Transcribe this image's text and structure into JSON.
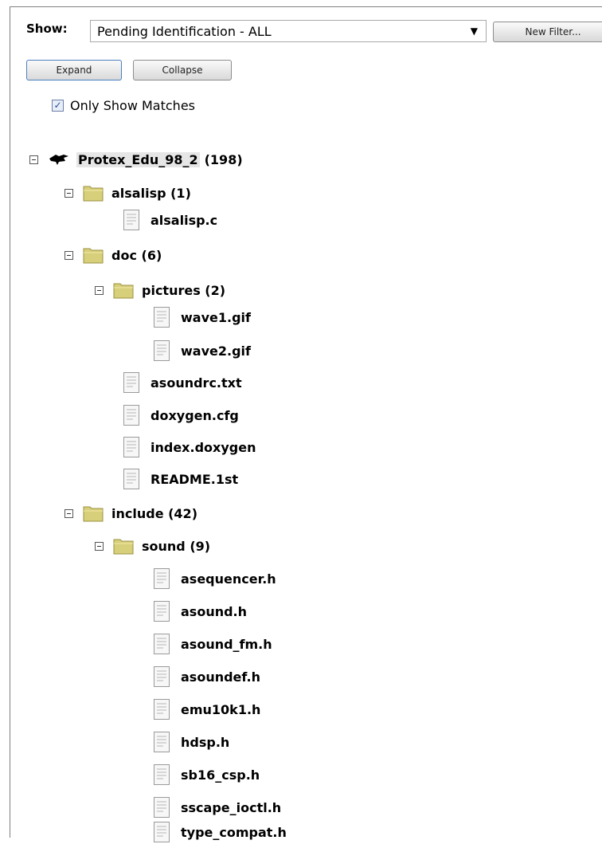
{
  "filter": {
    "show_label": "Show:",
    "selected": "Pending Identification - ALL",
    "new_filter_label": "New Filter..."
  },
  "actions": {
    "expand_label": "Expand",
    "collapse_label": "Collapse"
  },
  "only_show_matches": {
    "checked": true,
    "label": "Only Show Matches"
  },
  "tree": {
    "root": {
      "name": "Protex_Edu_98_2",
      "count": "(198)"
    },
    "nodes": [
      {
        "label": "alsalisp (1)",
        "type": "folder"
      },
      {
        "label": "alsalisp.c",
        "type": "file"
      },
      {
        "label": "doc (6)",
        "type": "folder"
      },
      {
        "label": "pictures (2)",
        "type": "folder"
      },
      {
        "label": "wave1.gif",
        "type": "file"
      },
      {
        "label": "wave2.gif",
        "type": "file"
      },
      {
        "label": "asoundrc.txt",
        "type": "file"
      },
      {
        "label": "doxygen.cfg",
        "type": "file"
      },
      {
        "label": "index.doxygen",
        "type": "file"
      },
      {
        "label": "README.1st",
        "type": "file"
      },
      {
        "label": "include (42)",
        "type": "folder"
      },
      {
        "label": "sound (9)",
        "type": "folder"
      },
      {
        "label": "asequencer.h",
        "type": "file"
      },
      {
        "label": "asound.h",
        "type": "file"
      },
      {
        "label": "asound_fm.h",
        "type": "file"
      },
      {
        "label": "asoundef.h",
        "type": "file"
      },
      {
        "label": "emu10k1.h",
        "type": "file"
      },
      {
        "label": "hdsp.h",
        "type": "file"
      },
      {
        "label": "sb16_csp.h",
        "type": "file"
      },
      {
        "label": "sscape_ioctl.h",
        "type": "file"
      },
      {
        "label": "type_compat.h",
        "type": "file"
      }
    ]
  },
  "icons": {
    "root": "bird-icon",
    "folder": "folder-icon",
    "file": "file-icon",
    "toggle": "collapse-toggle-icon",
    "dropdown": "chevron-down-icon"
  },
  "colors": {
    "folder": "#d8cf7a",
    "accent_border": "#4c7fbf",
    "check": "#2a4d9a"
  }
}
